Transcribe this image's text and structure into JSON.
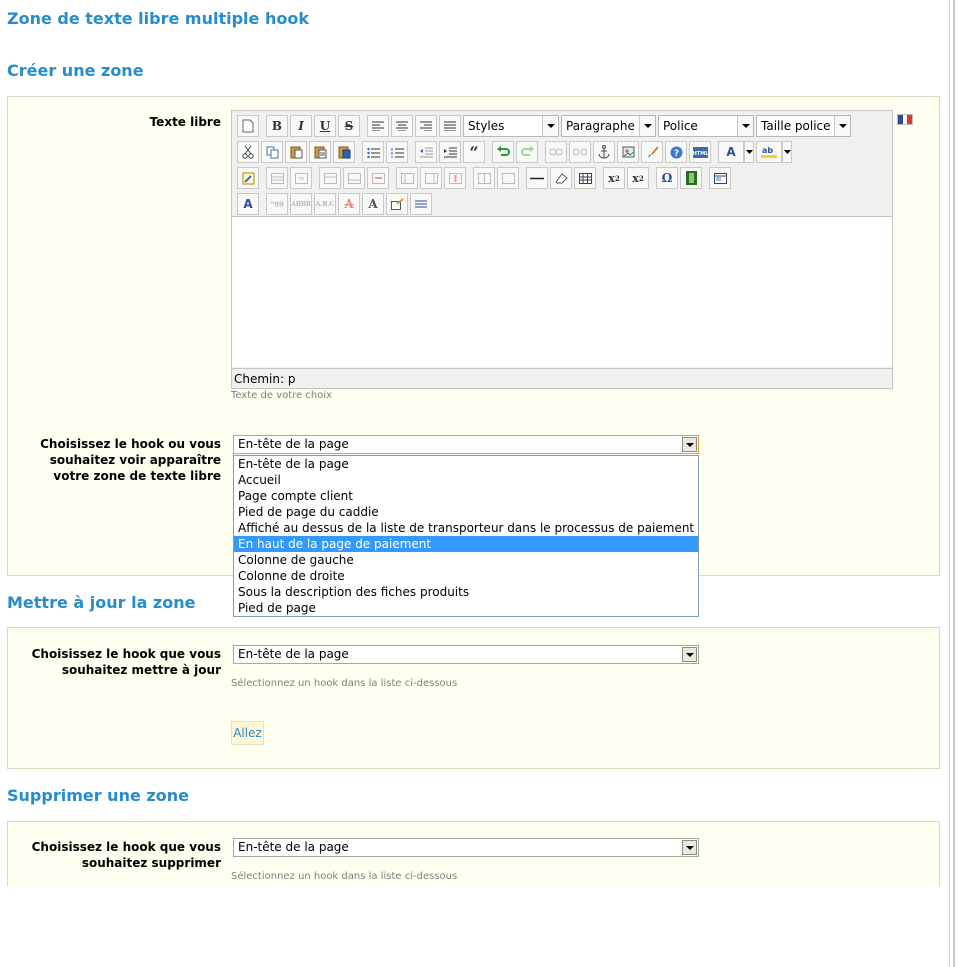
{
  "page_title": "Zone de texte libre multiple hook",
  "create": {
    "heading": "Créer une zone",
    "text_label": "Texte libre",
    "text_hint": "Texte de votre choix",
    "hook_label": "Choisissez le hook ou vous souhaitez voir apparaître votre zone de texte libre",
    "hook_value": "En-tête de la page",
    "hook_options": [
      "En-tête de la page",
      "Accueil",
      "Page compte client",
      "Pied de page du caddie",
      "Affiché au dessus de la liste de transporteur dans le processus de paiement",
      "En haut de la page de paiement",
      "Colonne de gauche",
      "Colonne de droite",
      "Sous la description des fiches produits",
      "Pied de page"
    ],
    "hook_highlighted_index": 5
  },
  "editor": {
    "dropdowns": {
      "styles": "Styles",
      "format": "Paragraphe",
      "font": "Police",
      "size": "Taille police"
    },
    "status_path": "Chemin: p",
    "flag_colors": [
      "#2b4ba0",
      "#ffffff",
      "#e0342c"
    ]
  },
  "update": {
    "heading": "Mettre à jour la zone",
    "hook_label": "Choisissez le hook que vous souhaitez mettre à jour",
    "hook_value": "En-tête de la page",
    "hint": "Sélectionnez un hook dans la liste ci-dessous",
    "submit": "Allez"
  },
  "delete": {
    "heading": "Supprimer une zone",
    "hook_label": "Choisissez le hook que vous souhaitez supprimer",
    "hook_value": "En-tête de la page",
    "hint": "Sélectionnez un hook dans la liste ci-dessous"
  },
  "colors": {
    "heading": "#268ccd",
    "panel_bg": "#fffff0",
    "selection": "#3399ff"
  }
}
